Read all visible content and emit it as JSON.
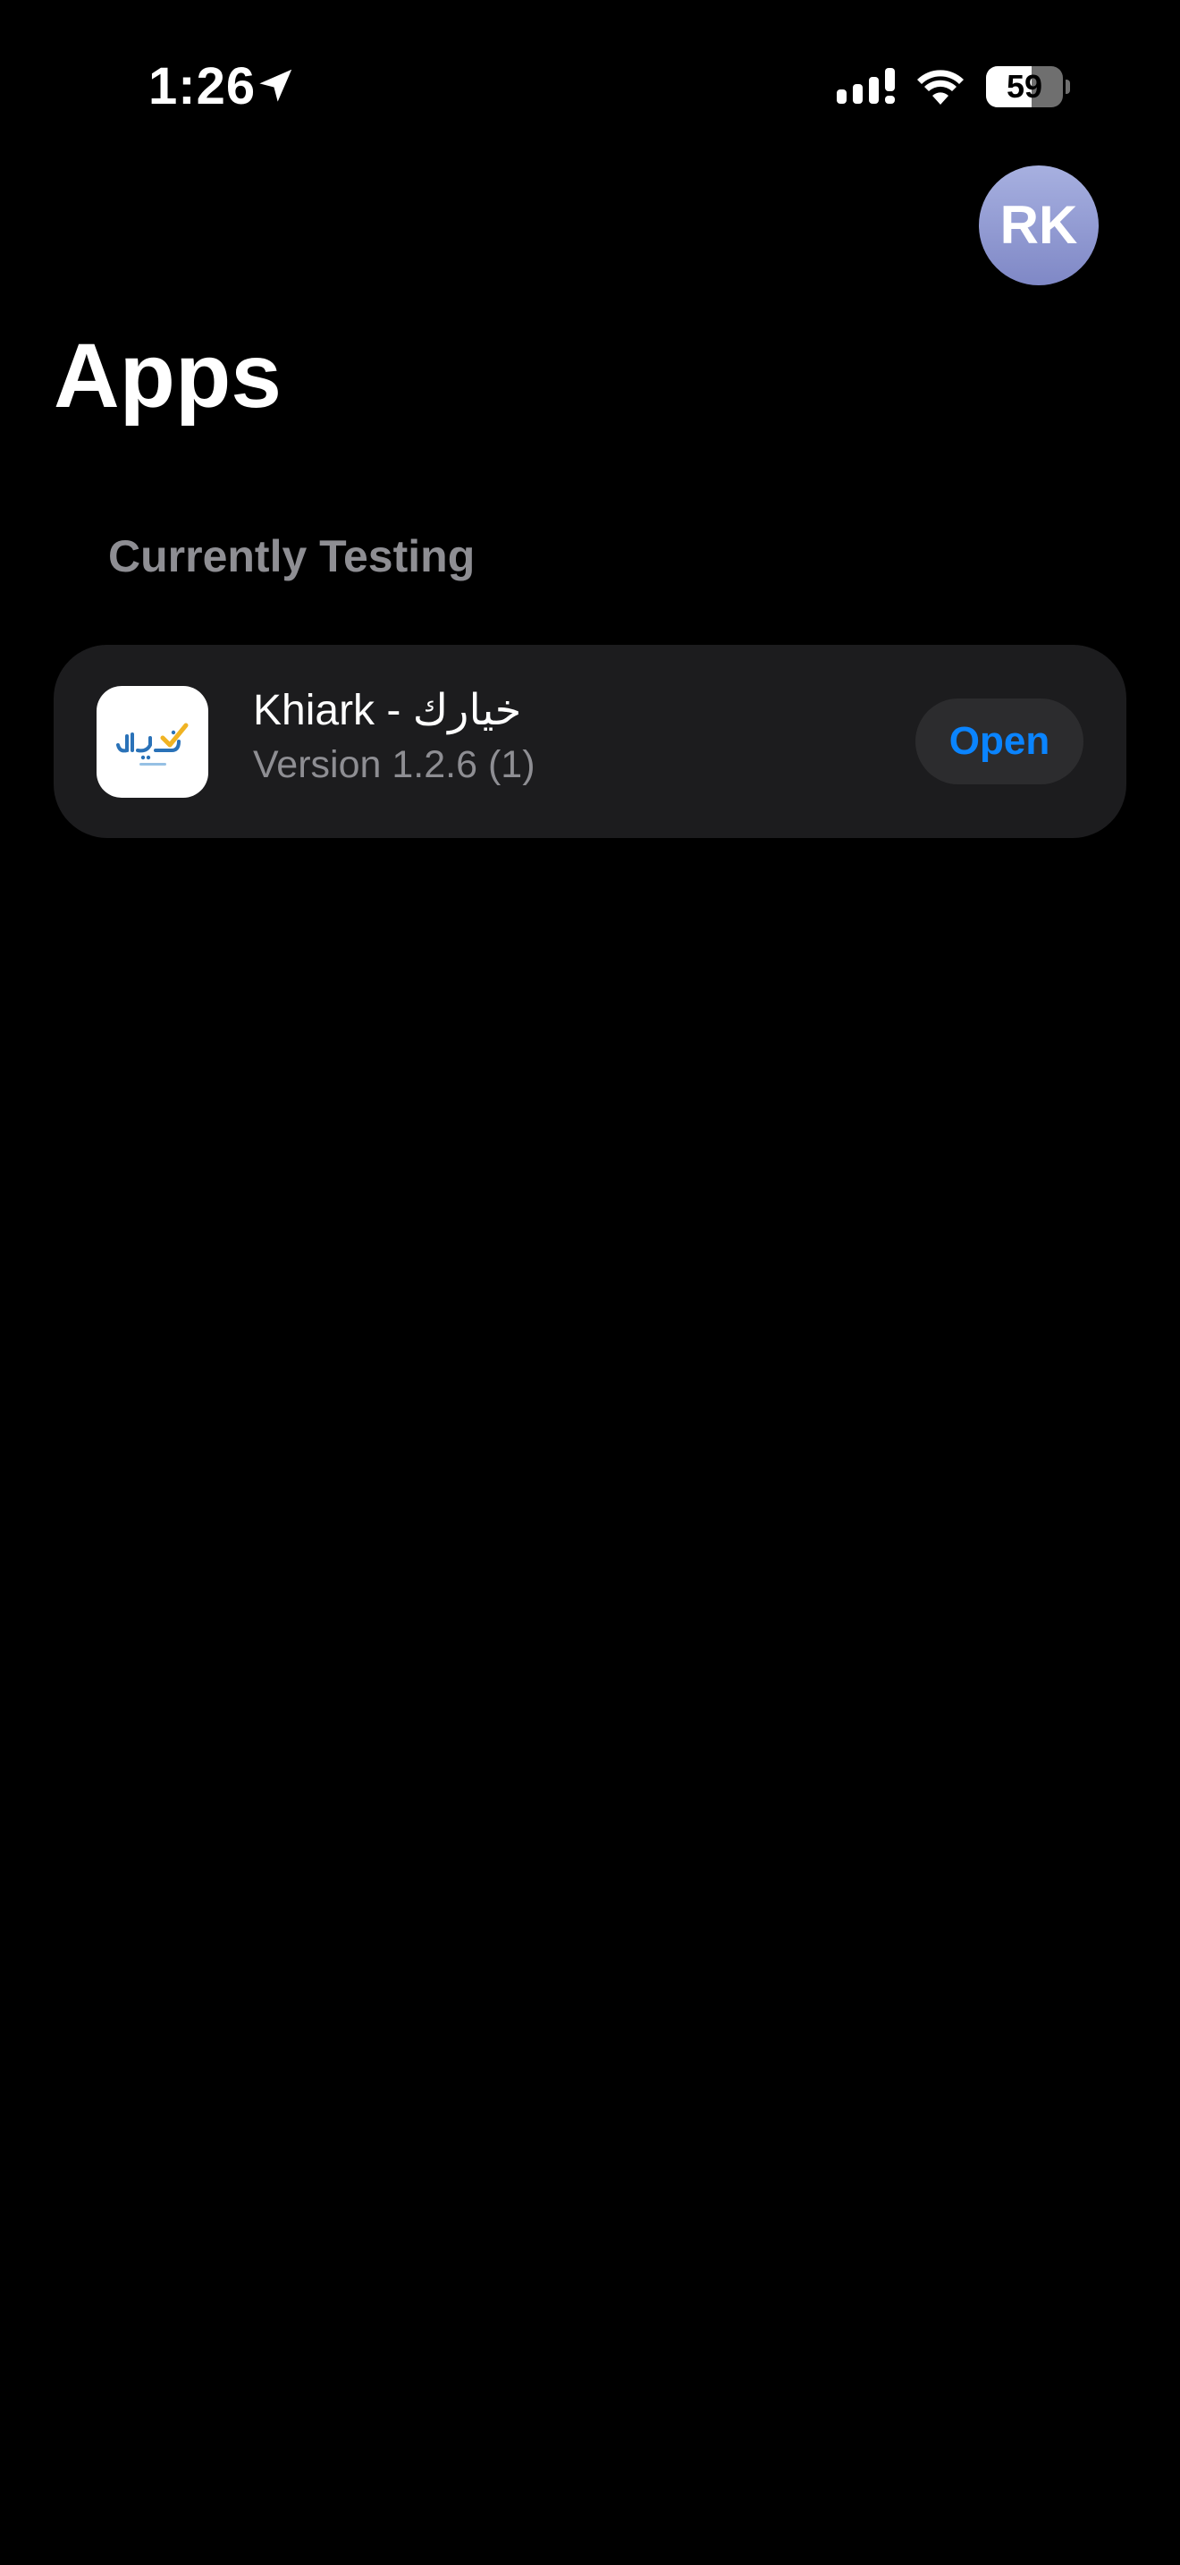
{
  "status_bar": {
    "time": "1:26",
    "location_icon": "location-arrow-icon",
    "signal_icon": "cellular-signal-icon",
    "wifi_icon": "wifi-icon",
    "battery_level": 59,
    "battery_text": "59"
  },
  "header": {
    "avatar_initials": "RK",
    "title": "Apps"
  },
  "section": {
    "title": "Currently Testing"
  },
  "apps": [
    {
      "name": "Khiark - خيارك",
      "version": "Version 1.2.6 (1)",
      "icon": "khiark-app-icon",
      "action_label": "Open"
    }
  ],
  "colors": {
    "background": "#000000",
    "card": "#1c1c1e",
    "button_bg": "#2c2c2e",
    "accent": "#0a84ff",
    "secondary_text": "#8e8e93",
    "avatar_top": "#a7b0e0",
    "avatar_bottom": "#7f88c6"
  }
}
